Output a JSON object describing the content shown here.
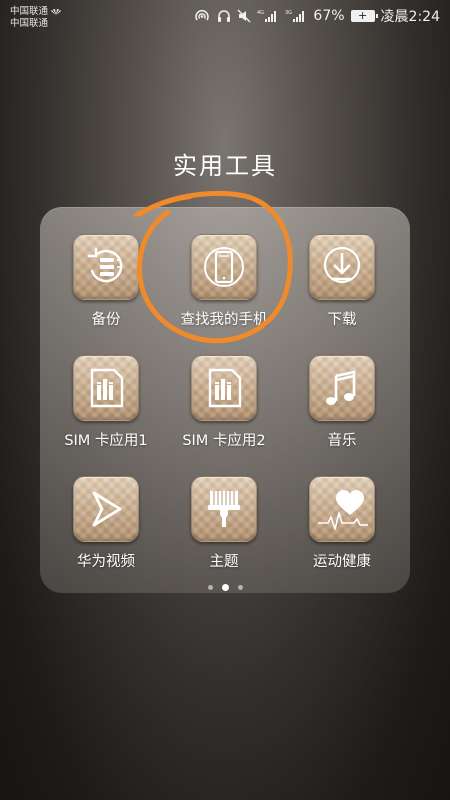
{
  "status_bar": {
    "carrier_1": "中国联通",
    "carrier_2": "中国联通",
    "network_1": "4G",
    "network_2": "3G",
    "battery_percent": "67%",
    "time": "凌晨2:24"
  },
  "folder": {
    "title": "实用工具",
    "apps": [
      {
        "label": "备份",
        "icon": "backup-icon"
      },
      {
        "label": "查找我的手机",
        "icon": "find-phone-icon"
      },
      {
        "label": "下载",
        "icon": "download-icon"
      },
      {
        "label": "SIM 卡应用1",
        "icon": "sim-card-icon"
      },
      {
        "label": "SIM 卡应用2",
        "icon": "sim-card-icon"
      },
      {
        "label": "音乐",
        "icon": "music-note-icon"
      },
      {
        "label": "华为视频",
        "icon": "video-play-icon"
      },
      {
        "label": "主题",
        "icon": "paint-brush-icon"
      },
      {
        "label": "运动健康",
        "icon": "heart-pulse-icon"
      }
    ],
    "page_count": 3,
    "active_page": 2
  },
  "colors": {
    "tile_gold": "#cfb394",
    "annotation_orange": "#f08a2a",
    "icon_white": "#ffffff"
  }
}
